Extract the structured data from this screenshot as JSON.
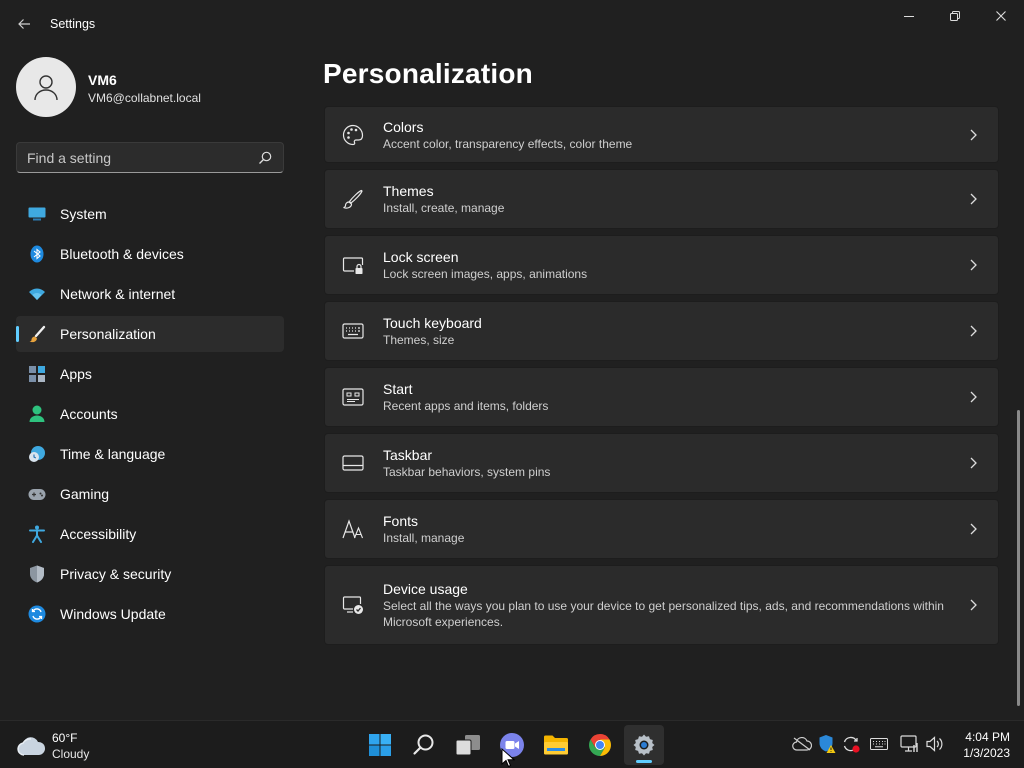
{
  "window": {
    "title": "Settings",
    "controls": [
      "minimize",
      "restore",
      "close"
    ]
  },
  "user": {
    "name": "VM6",
    "email": "VM6@collabnet.local"
  },
  "search": {
    "placeholder": "Find a setting",
    "value": ""
  },
  "sidebar": {
    "items": [
      {
        "label": "System",
        "icon": "system-icon",
        "active": false
      },
      {
        "label": "Bluetooth & devices",
        "icon": "bluetooth-icon",
        "active": false
      },
      {
        "label": "Network & internet",
        "icon": "wifi-icon",
        "active": false
      },
      {
        "label": "Personalization",
        "icon": "brush-icon",
        "active": true
      },
      {
        "label": "Apps",
        "icon": "apps-icon",
        "active": false
      },
      {
        "label": "Accounts",
        "icon": "accounts-icon",
        "active": false
      },
      {
        "label": "Time & language",
        "icon": "time-language-icon",
        "active": false
      },
      {
        "label": "Gaming",
        "icon": "gamepad-icon",
        "active": false
      },
      {
        "label": "Accessibility",
        "icon": "accessibility-icon",
        "active": false
      },
      {
        "label": "Privacy & security",
        "icon": "shield-icon",
        "active": false
      },
      {
        "label": "Windows Update",
        "icon": "update-icon",
        "active": false
      }
    ]
  },
  "page": {
    "title": "Personalization",
    "cards": [
      {
        "title": "Colors",
        "desc": "Accent color, transparency effects, color theme",
        "icon": "palette-icon"
      },
      {
        "title": "Themes",
        "desc": "Install, create, manage",
        "icon": "pen-icon"
      },
      {
        "title": "Lock screen",
        "desc": "Lock screen images, apps, animations",
        "icon": "lock-screen-icon"
      },
      {
        "title": "Touch keyboard",
        "desc": "Themes, size",
        "icon": "keyboard-icon"
      },
      {
        "title": "Start",
        "desc": "Recent apps and items, folders",
        "icon": "start-icon"
      },
      {
        "title": "Taskbar",
        "desc": "Taskbar behaviors, system pins",
        "icon": "taskbar-icon"
      },
      {
        "title": "Fonts",
        "desc": "Install, manage",
        "icon": "fonts-icon"
      },
      {
        "title": "Device usage",
        "desc": "Select all the ways you plan to use your device to get personalized tips, ads, and recommendations within Microsoft experiences.",
        "icon": "device-usage-icon"
      }
    ]
  },
  "taskbar": {
    "weather": {
      "temp": "60°F",
      "condition": "Cloudy"
    },
    "apps": [
      "windows-start-icon",
      "search-icon",
      "task-view-icon",
      "teams-chat-icon",
      "file-explorer-icon",
      "chrome-icon",
      "settings-icon"
    ],
    "active_app": "settings-icon",
    "tray": [
      "onedrive-icon",
      "defender-warning-icon",
      "sync-icon",
      "keyboard-icon",
      "network-icon",
      "volume-icon"
    ],
    "clock": {
      "time": "4:04 PM",
      "date": "1/3/2023"
    }
  },
  "colors": {
    "background": "#202020",
    "card": "#2b2b2b",
    "accent": "#60cdff",
    "taskbar": "#1c1c1c"
  }
}
